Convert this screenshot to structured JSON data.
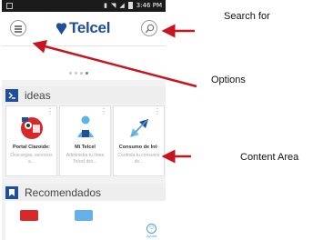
{
  "status_bar": {
    "time": "3:46 PM"
  },
  "app_bar": {
    "brand": "Telcel",
    "menu_icon": "hamburger-icon",
    "search_icon": "search-icon"
  },
  "carousel": {
    "pages": 4,
    "active": 3
  },
  "sections": {
    "ideas": {
      "title": "ideas",
      "cards": [
        {
          "title": "Portal Claroide:",
          "desc": "Descargas, servicios a..."
        },
        {
          "title": "Mi Telcel",
          "desc": "Administra tu línea Telcel des..."
        },
        {
          "title": "Consumo de Int·",
          "desc": "Controla tu consumo de..."
        }
      ]
    },
    "recomendados": {
      "title": "Recomendados"
    }
  },
  "help": {
    "label": "Ayuda"
  },
  "annotations": {
    "search": "Search for",
    "options": "Options",
    "content": "Content Area"
  },
  "colors": {
    "brand_blue": "#1f4f9a",
    "arrow_red": "#c8141e"
  }
}
